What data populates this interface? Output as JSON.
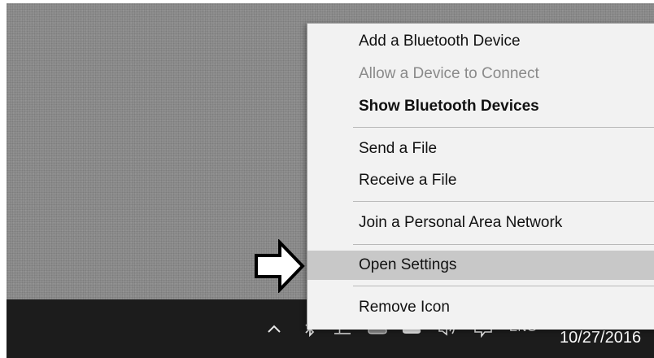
{
  "menu": {
    "items": [
      {
        "label": "Add a Bluetooth Device",
        "state": "enabled"
      },
      {
        "label": "Allow a Device to Connect",
        "state": "disabled"
      },
      {
        "label": "Show Bluetooth Devices",
        "state": "default"
      },
      {
        "label": "Send a File",
        "state": "enabled"
      },
      {
        "label": "Receive a File",
        "state": "enabled"
      },
      {
        "label": "Join a Personal Area Network",
        "state": "enabled"
      },
      {
        "label": "Open Settings",
        "state": "highlighted"
      },
      {
        "label": "Remove Icon",
        "state": "enabled"
      }
    ]
  },
  "taskbar": {
    "language": "ENG",
    "date": "10/27/2016",
    "tray_icons": [
      "chevron-up-icon",
      "bluetooth-icon",
      "network-icon",
      "cloud-icon",
      "cloud-filled-icon",
      "volume-icon",
      "action-center-icon"
    ]
  },
  "annotation": {
    "pointer": "right-arrow-icon"
  },
  "colors": {
    "desktop": "#8e8e8e",
    "taskbar": "#1c1c1c",
    "menu_background": "#f2f2f2",
    "menu_highlight": "#c8c8c8",
    "disabled_text": "#8a8a8a"
  }
}
